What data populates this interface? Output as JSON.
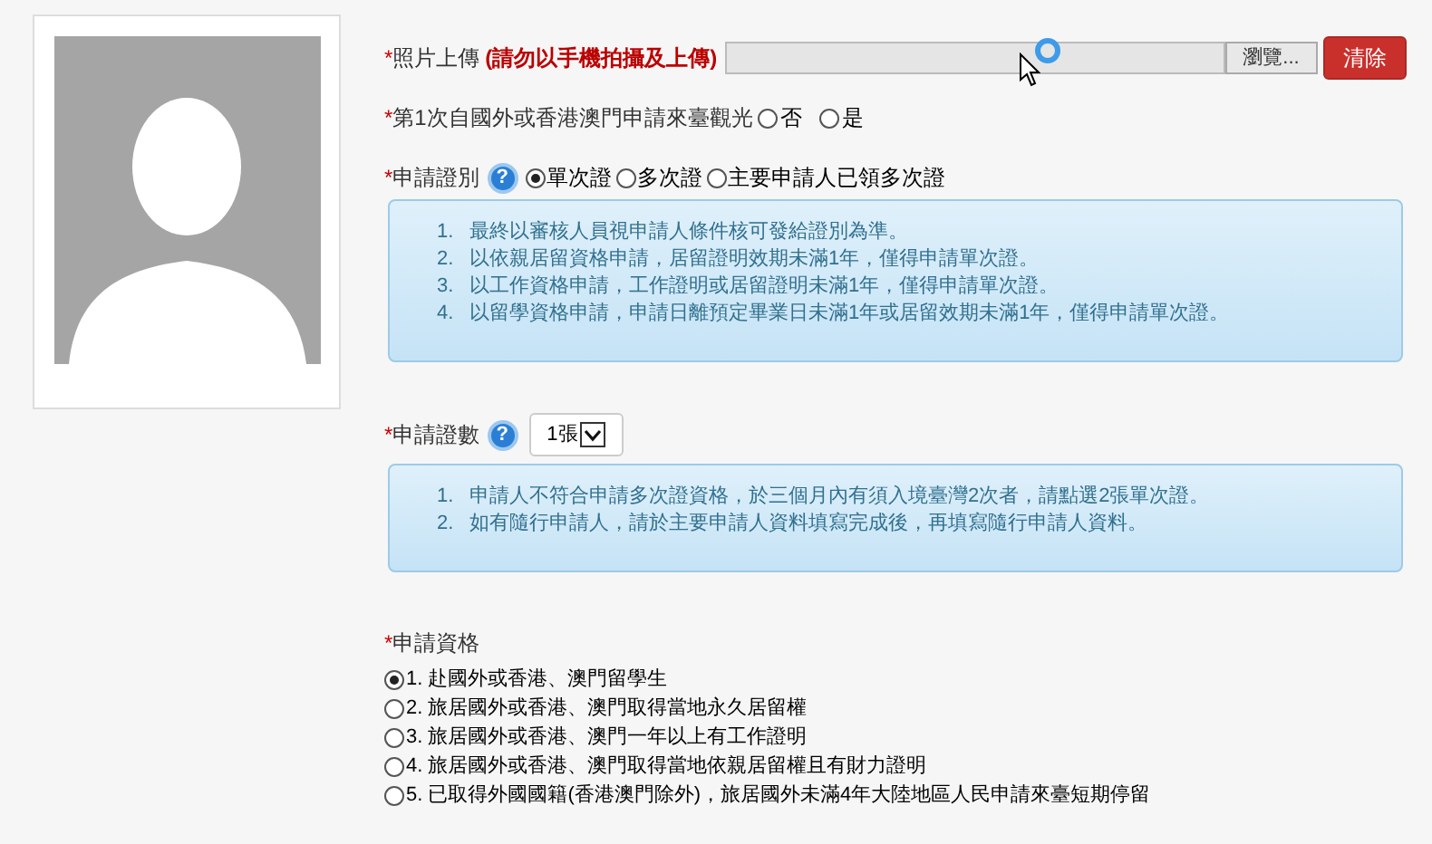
{
  "photo_upload": {
    "required_mark": "*",
    "label": "照片上傳",
    "note": "(請勿以手機拍攝及上傳)",
    "browse_button": "瀏覽...",
    "clear_button": "清除"
  },
  "first_time": {
    "required_mark": "*",
    "label": "第1次自國外或香港澳門申請來臺觀光",
    "options": [
      {
        "label": "否",
        "selected": false
      },
      {
        "label": "是",
        "selected": false
      }
    ]
  },
  "visa_type": {
    "required_mark": "*",
    "label": "申請證別",
    "help": "?",
    "options": [
      {
        "label": "單次證",
        "selected": true
      },
      {
        "label": "多次證",
        "selected": false
      },
      {
        "label": "主要申請人已領多次證",
        "selected": false
      }
    ],
    "notes": [
      {
        "number": "1.",
        "text": "最終以審核人員視申請人條件核可發給證別為準。"
      },
      {
        "number": "2.",
        "text": "以依親居留資格申請，居留證明效期未滿1年，僅得申請單次證。"
      },
      {
        "number": "3.",
        "text": "以工作資格申請，工作證明或居留證明未滿1年，僅得申請單次證。"
      },
      {
        "number": "4.",
        "text": "以留學資格申請，申請日離預定畢業日未滿1年或居留效期未滿1年，僅得申請單次證。"
      }
    ]
  },
  "visa_count": {
    "required_mark": "*",
    "label": "申請證數",
    "help": "?",
    "value": "1張",
    "notes": [
      {
        "number": "1.",
        "text": "申請人不符合申請多次證資格，於三個月內有須入境臺灣2次者，請點選2張單次證。"
      },
      {
        "number": "2.",
        "text": "如有隨行申請人，請於主要申請人資料填寫完成後，再填寫隨行申請人資料。"
      }
    ]
  },
  "qualification": {
    "required_mark": "*",
    "label": "申請資格",
    "options": [
      {
        "label": "1. 赴國外或香港、澳門留學生",
        "selected": true
      },
      {
        "label": "2. 旅居國外或香港、澳門取得當地永久居留權",
        "selected": false
      },
      {
        "label": "3. 旅居國外或香港、澳門一年以上有工作證明",
        "selected": false
      },
      {
        "label": "4. 旅居國外或香港、澳門取得當地依親居留權且有財力證明",
        "selected": false
      },
      {
        "label": "5. 已取得外國國籍(香港澳門除外)，旅居國外未滿4年大陸地區人民申請來臺短期停留",
        "selected": false
      }
    ]
  }
}
